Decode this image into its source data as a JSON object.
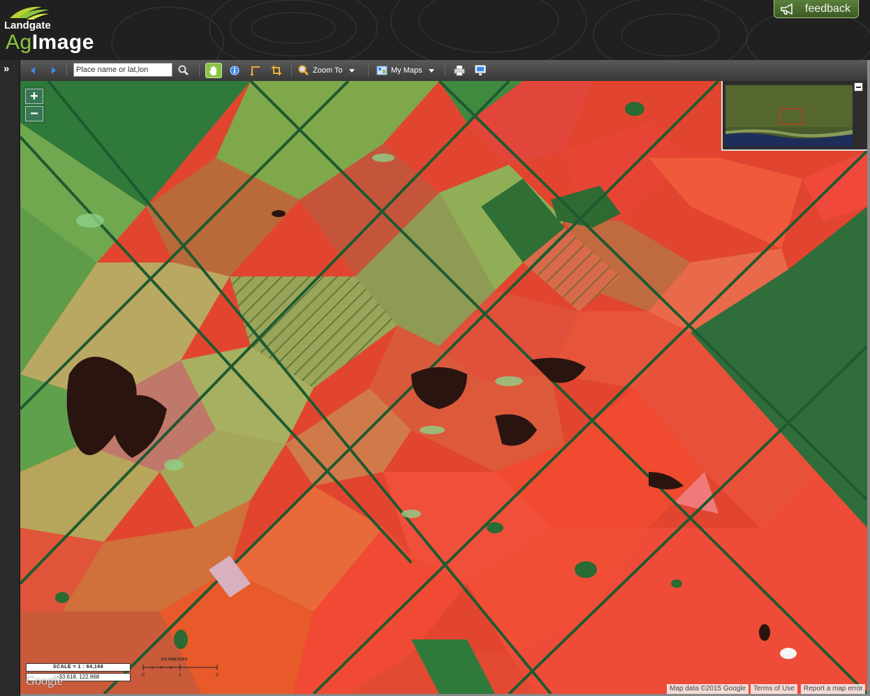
{
  "app": {
    "brand": "Landgate",
    "product_ag": "Ag",
    "product_image": "Image"
  },
  "feedback": {
    "label": "feedback",
    "icon": "megaphone-icon"
  },
  "sidebar": {
    "expand_glyph": "»"
  },
  "toolbar": {
    "search": {
      "placeholder": "Place name or lat,lon",
      "value": ""
    },
    "zoom_to_label": "Zoom To",
    "my_maps_label": "My Maps",
    "active_tool": "pan"
  },
  "map": {
    "zoom_in": "+",
    "zoom_out": "−",
    "scale_text": "SCALE = 1 : 64,168",
    "coord_text": "-33.618, 122.868",
    "scalebar": {
      "units": "KILOMETERS",
      "ticks": [
        "0",
        "1",
        "2"
      ]
    },
    "google_label": "Google",
    "attribution": [
      "Map data ©2015 Google",
      "Terms of Use",
      "Report a map error"
    ]
  }
}
